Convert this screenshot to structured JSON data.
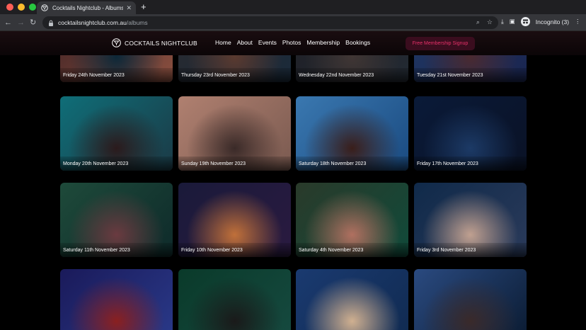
{
  "browser": {
    "tab_title": "Cocktails Nightclub - Albums",
    "url_host": "cocktailsnightclub.com.au",
    "url_path": "/albums",
    "profile_label": "Incognito (3)",
    "colors": {
      "close": "#ff5f57",
      "minimize": "#febc2e",
      "maximize": "#28c840"
    }
  },
  "site": {
    "logo_text": "COCKTAILS NIGHTCLUB",
    "menu": [
      "Home",
      "About",
      "Events",
      "Photos",
      "Membership",
      "Bookings"
    ],
    "signup_label": "Free Membership Signup",
    "accent": "#e8316a"
  },
  "albums": [
    {
      "date": "Friday 24th November 2023",
      "colors": [
        "#3a1f22",
        "#0d2838",
        "#8b5040"
      ]
    },
    {
      "date": "Thursday 23rd November 2023",
      "colors": [
        "#2b2a2e",
        "#5a3a30",
        "#1a2a3a"
      ]
    },
    {
      "date": "Wednesday 22nd November 2023",
      "colors": [
        "#1e1e24",
        "#403634",
        "#232a33"
      ]
    },
    {
      "date": "Tuesday 21st November 2023",
      "colors": [
        "#203a66",
        "#4a2a30",
        "#1a2550"
      ]
    },
    {
      "date": "Monday 20th November 2023",
      "colors": [
        "#0f6e78",
        "#2b1a1c",
        "#1b3a46"
      ]
    },
    {
      "date": "Sunday 19th November 2023",
      "colors": [
        "#b08070",
        "#3a2a28",
        "#7a5a50"
      ]
    },
    {
      "date": "Saturday 18th November 2023",
      "colors": [
        "#3a78b0",
        "#3a1e1a",
        "#1a4a80"
      ]
    },
    {
      "date": "Friday 17th November 2023",
      "colors": [
        "#0a1a38",
        "#1c3a66",
        "#0a1226"
      ]
    },
    {
      "date": "Saturday 11th November 2023",
      "colors": [
        "#1e4a3a",
        "#6a3a40",
        "#0e2a2a"
      ]
    },
    {
      "date": "Friday 10th November 2023",
      "colors": [
        "#1a1a3a",
        "#c0703a",
        "#2a1a40"
      ]
    },
    {
      "date": "Saturday 4th November 2023",
      "colors": [
        "#2a3a2a",
        "#b07060",
        "#104a3a"
      ]
    },
    {
      "date": "Friday 3rd November 2023",
      "colors": [
        "#102a4a",
        "#c0a090",
        "#2a3a5a"
      ]
    },
    {
      "date": "",
      "colors": [
        "#1a1a5a",
        "#8a2020",
        "#2a3a8a"
      ]
    },
    {
      "date": "",
      "colors": [
        "#0a3a2a",
        "#1a1a1a",
        "#164a40"
      ]
    },
    {
      "date": "",
      "colors": [
        "#1a3a70",
        "#d0b090",
        "#102a50"
      ]
    },
    {
      "date": "",
      "colors": [
        "#2a4a80",
        "#3a2a2a",
        "#0a1a30"
      ]
    }
  ]
}
